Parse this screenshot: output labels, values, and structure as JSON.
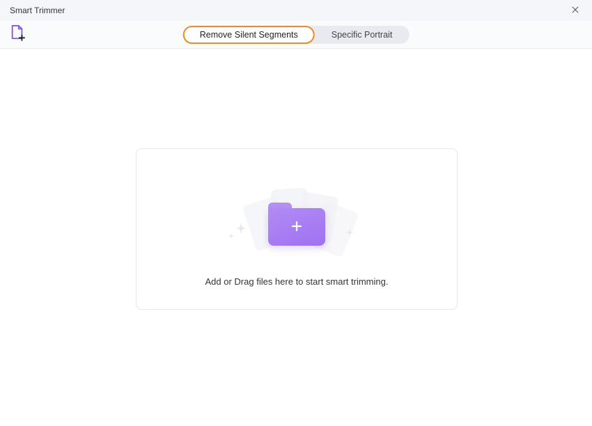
{
  "window": {
    "title": "Smart Trimmer"
  },
  "tabs": {
    "remove_silent": "Remove Silent Segments",
    "specific_portrait": "Specific Portrait"
  },
  "dropzone": {
    "prompt": "Add or Drag files here to start smart trimming."
  }
}
